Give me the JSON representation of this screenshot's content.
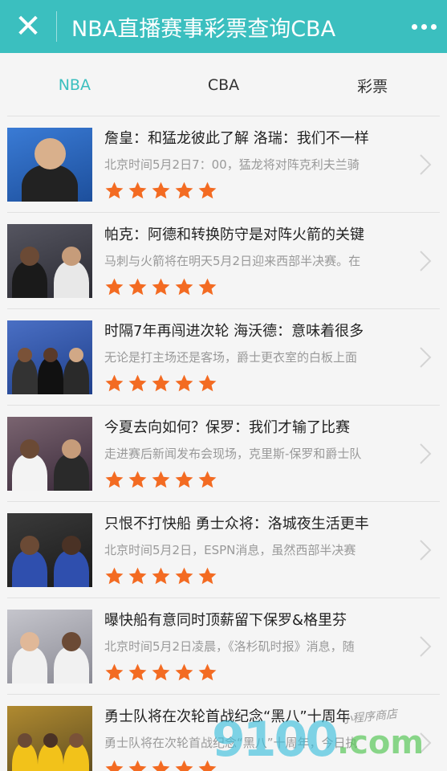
{
  "header": {
    "title": "NBA直播赛事彩票查询CBA",
    "close_icon": "close-icon",
    "more_icon": "more-dots-icon",
    "bg_color": "#3bbfbf"
  },
  "tabs": [
    {
      "label": "NBA",
      "active": true
    },
    {
      "label": "CBA",
      "active": false
    },
    {
      "label": "彩票",
      "active": false
    }
  ],
  "accent_color": "#3bbfbf",
  "star_color": "#f36b22",
  "articles": [
    {
      "title": "詹皇：和猛龙彼此了解 洛瑞：我们不一样",
      "summary": "北京时间5月2日7：00，猛龙将对阵克利夫兰骑",
      "rating": 5
    },
    {
      "title": "帕克：阿德和转换防守是对阵火箭的关键",
      "summary": "马刺与火箭将在明天5月2日迎来西部半决赛。在",
      "rating": 5
    },
    {
      "title": "时隔7年再闯进次轮 海沃德：意味着很多",
      "summary": "无论是打主场还是客场，爵士更衣室的白板上面",
      "rating": 5
    },
    {
      "title": "今夏去向如何？保罗：我们才输了比赛",
      "summary": "走进赛后新闻发布会现场，克里斯-保罗和爵士队",
      "rating": 5
    },
    {
      "title": "只恨不打快船 勇士众将：洛城夜生活更丰",
      "summary": "北京时间5月2日，ESPN消息，虽然西部半决赛",
      "rating": 5
    },
    {
      "title": "曝快船有意同时顶薪留下保罗&格里芬",
      "summary": "北京时间5月2日凌晨，《洛杉矶时报》消息，随",
      "rating": 5
    },
    {
      "title": "勇士队将在次轮首战纪念“黑八”十周年",
      "summary": "勇士队将在次轮首战纪念“黑八”十周年，今日执",
      "rating": 5
    }
  ],
  "watermark": {
    "text": "9100",
    "suffix": ".com",
    "signature": "小程序商店"
  }
}
